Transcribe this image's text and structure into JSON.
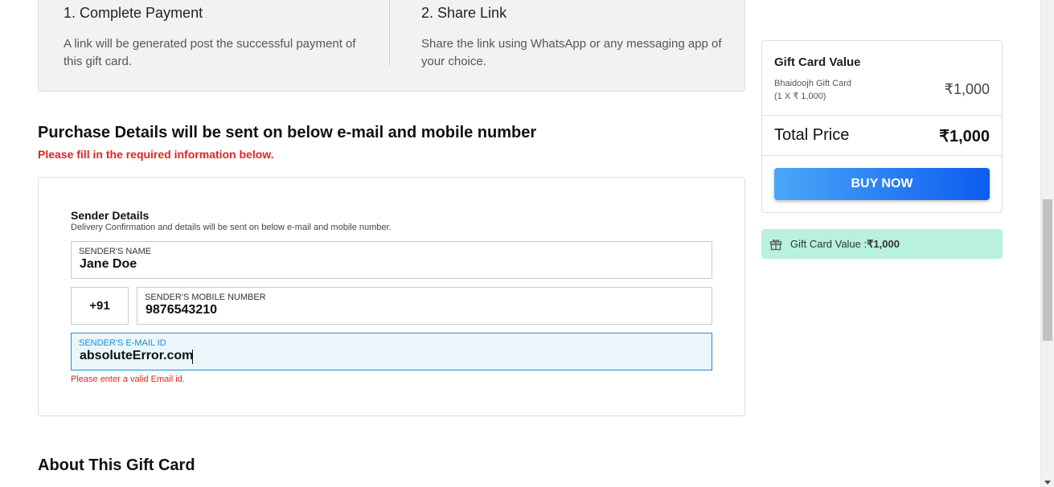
{
  "steps": [
    {
      "title": "1. Complete Payment",
      "desc": "A link will be generated post the successful payment of this gift card."
    },
    {
      "title": "2. Share Link",
      "desc": "Share the link using WhatsApp or any messaging app of your choice."
    }
  ],
  "purchase": {
    "title": "Purchase Details will be sent on below e-mail and mobile number",
    "required_note": "Please fill in the required information below."
  },
  "sender": {
    "title": "Sender Details",
    "subtitle": "Delivery Confirmation and details will be sent on below e-mail and mobile number.",
    "name_label": "SENDER'S NAME",
    "name_value": "Jane Doe",
    "country_code": "+91",
    "mobile_label": "SENDER'S MOBILE NUMBER",
    "mobile_value": "9876543210",
    "email_label": "SENDER'S E-MAIL ID",
    "email_value": "absoluteError.com",
    "email_error": "Please enter a valid Email id."
  },
  "about": {
    "title": "About This Gift Card"
  },
  "summary": {
    "title": "Gift Card Value",
    "item_name": "Bhaidoojh Gift Card",
    "item_qty": "(1 X ₹ 1,000)",
    "item_amount": "₹1,000",
    "total_label": "Total Price",
    "total_amount": "₹1,000",
    "buy_label": "BUY NOW"
  },
  "gift_banner": {
    "label": "Gift Card Value : ",
    "amount": "₹1,000",
    "icon": "gift-icon"
  },
  "colors": {
    "accent": "#1a8fd6",
    "error": "#e02424",
    "banner_bg": "#b9f2dc",
    "button_start": "#4aa8f8",
    "button_end": "#0d5cf0"
  }
}
